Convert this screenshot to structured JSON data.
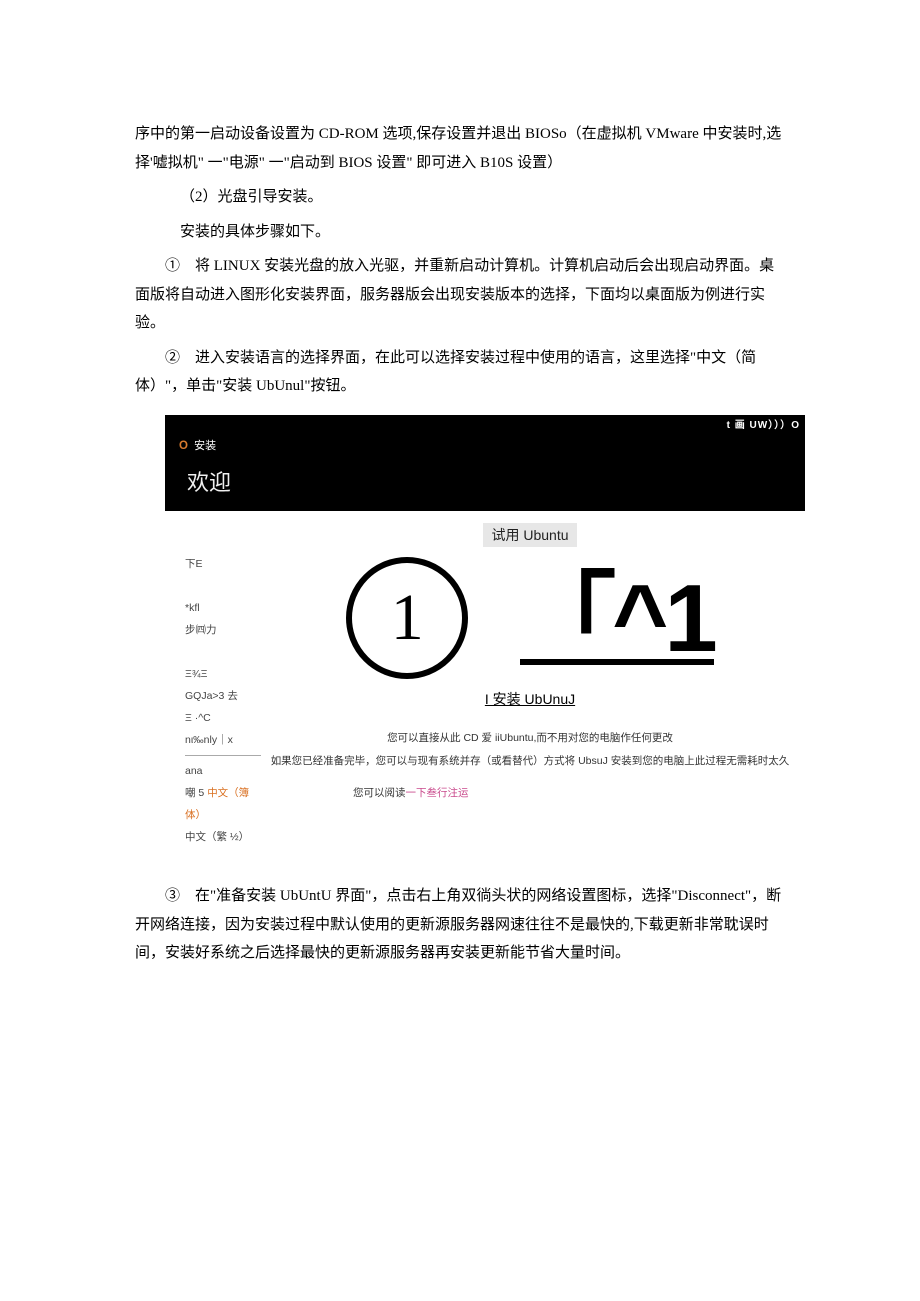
{
  "body": {
    "p1": "序中的第一启动设备设置为 CD-ROM 选项,保存设置并退出 BIOSo（在虚拟机 VMware 中安装时,选择'嘘拟机\" 一\"电源\" 一\"启动到 BIOS 设置\" 即可进入 B10S 设置）",
    "p2": "（2）光盘引导安装。",
    "p3": "安装的具体步骤如下。",
    "p4": "①　将 LINUX 安装光盘的放入光驱，并重新启动计算机。计算机启动后会出现启动界面。桌面版将自动进入图形化安装界面，服务器版会出现安装版本的选择，下面均以桌面版为例进行实验。",
    "p5": "②　进入安装语言的选择界面，在此可以选择安装过程中使用的语言，这里选择\"中文（简体）\"，单击\"安装 UbUnul\"按钮。",
    "p6": "③　在\"准备安装 UbUntU 界面\"，点击右上角双徜头状的网络设置图标，选择\"Disconnect\"，断开网络连接，因为安装过程中默认使用的更新源服务器网速往往不是最快的,下载更新非常耽误时间，安装好系统之后选择最快的更新源服务器再安装更新能节省大量时间。"
  },
  "installer": {
    "topbar": "t 画 UW）））O",
    "close_mark": "O",
    "header_install": "安装",
    "welcome": "欢迎",
    "try_button": "试用 Ubuntu",
    "circle_num": "1",
    "caret": "「^1",
    "install_button": "I 安装 UbUnuJ",
    "desc1": "您可以直接从此 CD 爱 iiUbuntu,而不用对您的电脑作任何更改",
    "desc2": "如果您已经准备完毕，您可以与现有系统并存（或看替代）方式将 UbsuJ 安装到您的电脑上此过程无需耗时太久",
    "read_prefix": "您可以阅读",
    "read_link": "一下叁行注运",
    "lang": {
      "l1": "下E",
      "l2": "*kfl",
      "l3": "步㈣力",
      "l4": "Ξ¾Ξ",
      "l5": "GQJa>3 去",
      "l6": "Ξ ·^C",
      "l7": "nι‰nly｜x",
      "l8": "ana",
      "l9a": "嘲 5 ",
      "l9b": "中文（簿体）",
      "l10": "中文（繁 ½）"
    }
  }
}
